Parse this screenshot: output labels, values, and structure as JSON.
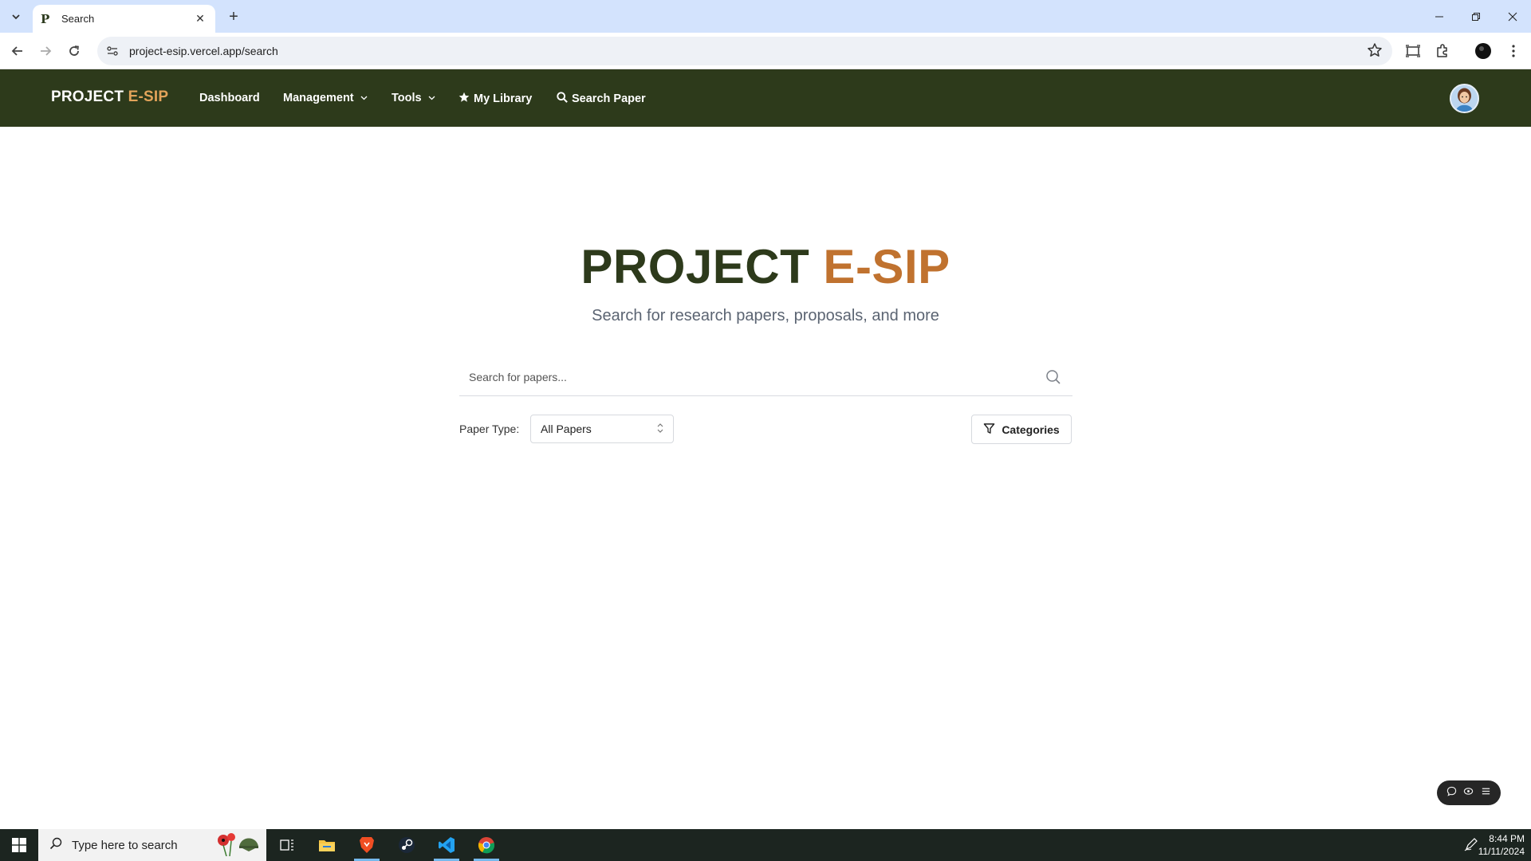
{
  "browser": {
    "tab_title": "Search",
    "favicon_letter": "P",
    "url": "project-esip.vercel.app/search"
  },
  "navbar": {
    "brand_main": "PROJECT ",
    "brand_accent": "E-SIP",
    "items": [
      {
        "label": "Dashboard"
      },
      {
        "label": "Management"
      },
      {
        "label": "Tools"
      },
      {
        "label": "My Library"
      },
      {
        "label": "Search Paper"
      }
    ]
  },
  "hero": {
    "title_main": "PROJECT ",
    "title_accent": "E-SIP",
    "subtitle": "Search for research papers, proposals, and more"
  },
  "search": {
    "placeholder": "Search for papers...",
    "value": ""
  },
  "filters": {
    "paper_type_label": "Paper Type:",
    "paper_type_selected": "All Papers",
    "categories_label": "Categories"
  },
  "taskbar": {
    "search_placeholder": "Type here to search",
    "time": "8:44 PM",
    "date": "11/11/2024"
  },
  "colors": {
    "nav_bg": "#2d3a1b",
    "accent": "#c0722f",
    "brand_accent": "#e2a35a"
  }
}
